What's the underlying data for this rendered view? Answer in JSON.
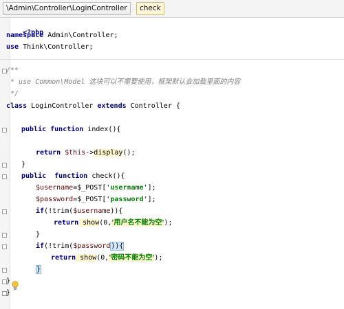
{
  "breadcrumb": {
    "path": "\\Admin\\Controller\\LoginController",
    "method": "check"
  },
  "code": {
    "l1": "<?php",
    "l2_kw": "namespace",
    "l2_rest": " Admin\\Controller;",
    "l3_kw": "use",
    "l3_rest": " Think\\Controller;",
    "l4": "/**",
    "l5_a": " * use Common\\Model ",
    "l5_b": "这块可以不需要使用，框架默认会加载里面的内容",
    "l6": " */",
    "l7_kw": "class",
    "l7_name": " LoginController ",
    "l7_ext": "extends",
    "l7_rest": " Controller {",
    "l8_kw1": "public",
    "l8_kw2": " function",
    "l8_rest": " index(){",
    "l9_kw": "return",
    "l9_var": " $this",
    "l9_arrow": "->",
    "l9_fn": "display",
    "l9_rest": "();",
    "l10": "}",
    "l11_kw1": "public",
    "l11_kw2": "  function",
    "l11_rest": " check(){",
    "l12_var": "$username",
    "l12_mid": "=$_POST[",
    "l12_str": "'username'",
    "l12_end": "];",
    "l13_var": "$password",
    "l13_mid": "=$_POST[",
    "l13_str": "'password'",
    "l13_end": "];",
    "l14_kw": "if",
    "l14_a": "(!trim(",
    "l14_var": "$username",
    "l14_b": ")){",
    "l15_kw": "return",
    "l15_fn": " show",
    "l15_a": "(0,",
    "l15_str": "'用户名不能为空'",
    "l15_end": ");",
    "l16": "}",
    "l17_kw": "if",
    "l17_a": "(!trim(",
    "l17_var": "$password",
    "l17_b": ")){",
    "l18_kw": "return",
    "l18_fn": " show",
    "l18_a": "(0,",
    "l18_str": "'密码不能为空'",
    "l18_end": ");",
    "l19": "}",
    "l20": "}",
    "l21": "}"
  },
  "icons": {
    "intention": "lightbulb-icon"
  }
}
